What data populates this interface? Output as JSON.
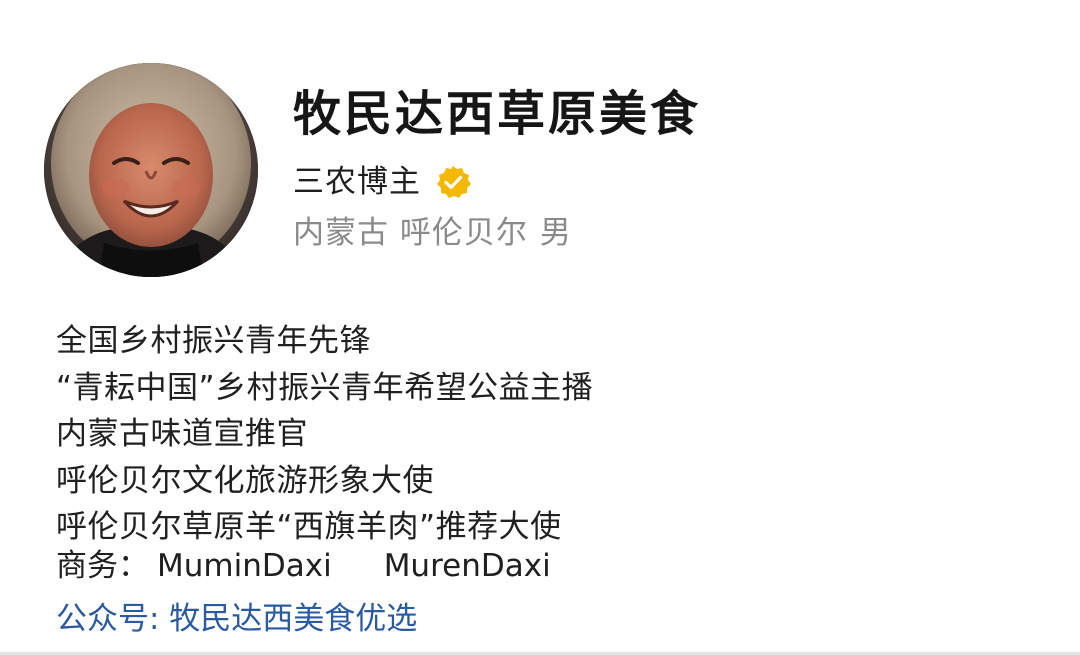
{
  "profile": {
    "account_name": "牧民达西草原美食",
    "category": "三农博主",
    "verified_icon": "verified-badge-icon",
    "verified_color": "#f5b800",
    "region": "内蒙古 呼伦贝尔",
    "gender": "男"
  },
  "bio": {
    "lines": [
      "全国乡村振兴青年先锋",
      "“青耘中国”乡村振兴青年希望公益主播",
      "内蒙古味道宣推官",
      "呼伦贝尔文化旅游形象大使",
      "呼伦贝尔草原羊“西旗羊肉”推荐大使"
    ],
    "business_label": "商务：",
    "business_ids": [
      "MuminDaxi",
      "MurenDaxi"
    ]
  },
  "public_account": {
    "text": "公众号: 牧民达西美食优选",
    "color": "#2a5aa0"
  }
}
